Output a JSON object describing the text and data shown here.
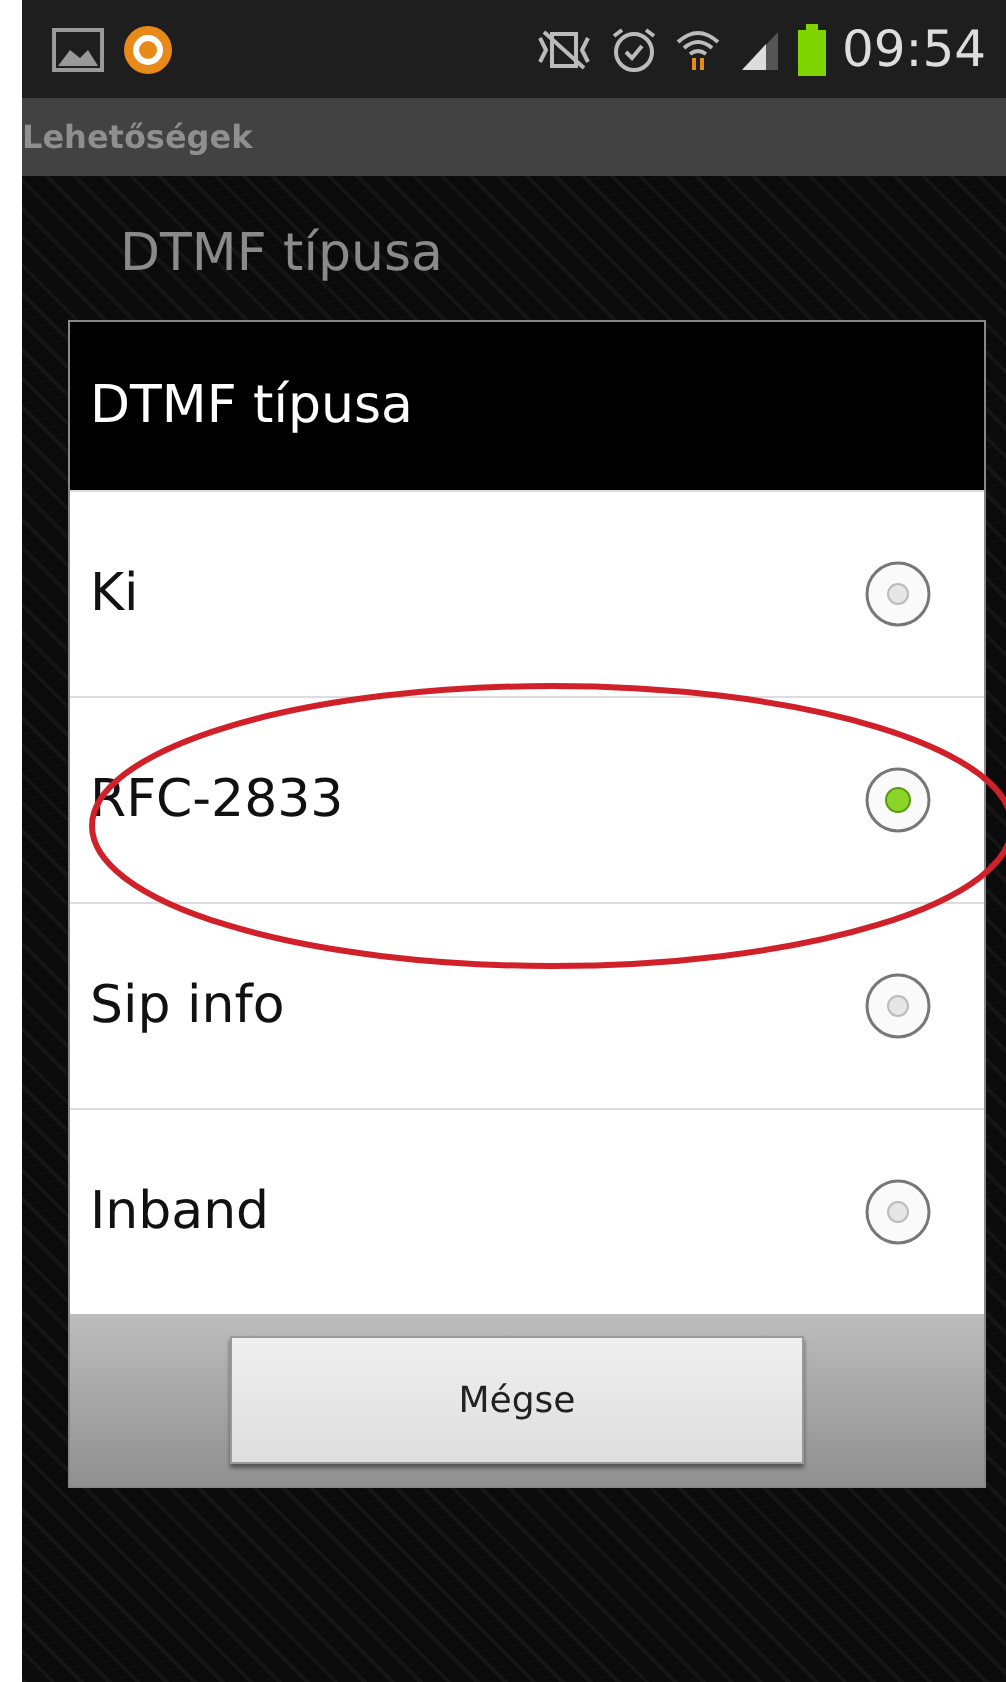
{
  "status_bar": {
    "time": "09:54"
  },
  "action_bar": {
    "title": "Lehetőségek"
  },
  "background_preference": {
    "title": "DTMF típusa"
  },
  "dialog": {
    "title": "DTMF típusa",
    "options": [
      {
        "label": "Ki",
        "selected": false
      },
      {
        "label": "RFC-2833",
        "selected": true
      },
      {
        "label": "Sip info",
        "selected": false
      },
      {
        "label": "Inband",
        "selected": false
      }
    ],
    "cancel_button": "Mégse"
  },
  "annotation": {
    "kind": "ellipse",
    "color": "#d0202a"
  }
}
